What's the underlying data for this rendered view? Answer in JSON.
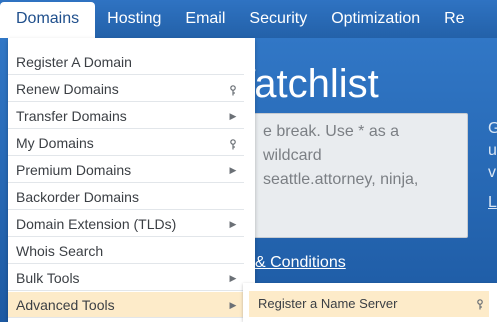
{
  "nav": {
    "items": [
      "Domains",
      "Hosting",
      "Email",
      "Security",
      "Optimization",
      "Re"
    ]
  },
  "page": {
    "title": "Watchlist",
    "textarea_lines": [
      "e break. Use * as a wildcard",
      "seattle.attorney, ninja,"
    ],
    "conditions_link": "& Conditions",
    "side_letters": [
      "G",
      "u",
      "v"
    ],
    "side_link": "L"
  },
  "dropdown": {
    "items": [
      {
        "label": "Register A Domain",
        "indicator": ""
      },
      {
        "label": "Renew Domains",
        "indicator": "key-icon"
      },
      {
        "label": "Transfer Domains",
        "indicator": "arrow"
      },
      {
        "label": "My Domains",
        "indicator": "key-icon"
      },
      {
        "label": "Premium Domains",
        "indicator": "arrow"
      },
      {
        "label": "Backorder Domains",
        "indicator": ""
      },
      {
        "label": "Domain Extension (TLDs)",
        "indicator": "arrow"
      },
      {
        "label": "Whois Search",
        "indicator": ""
      },
      {
        "label": "Bulk Tools",
        "indicator": "arrow"
      },
      {
        "label": "Advanced Tools",
        "indicator": "arrow"
      }
    ]
  },
  "submenu": {
    "items": [
      {
        "label": "Register a Name Server",
        "indicator": "key-icon"
      }
    ]
  },
  "colors": {
    "nav_bg": "#2a6ab6",
    "page_bg": "#2a6ab6",
    "highlight": "#fdebc9",
    "menu_text": "#3b3f44"
  }
}
